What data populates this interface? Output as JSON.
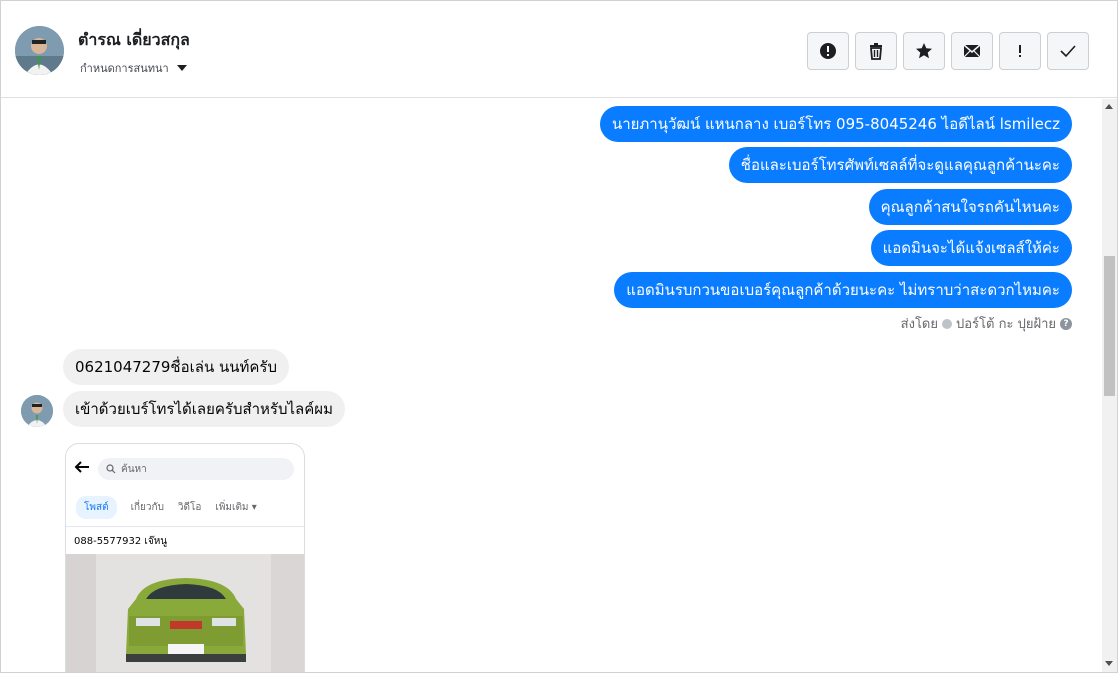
{
  "contact": {
    "name": "ตำรณ เดี่ยวสกุล",
    "subtitle": "กำหนดการสนทนา"
  },
  "toolbar": {
    "buttons": [
      {
        "name": "alert",
        "icon": "alert-circle-icon"
      },
      {
        "name": "delete",
        "icon": "trash-icon"
      },
      {
        "name": "star",
        "icon": "star-icon"
      },
      {
        "name": "mail",
        "icon": "envelope-icon"
      },
      {
        "name": "important",
        "icon": "exclamation-icon"
      },
      {
        "name": "done",
        "icon": "check-icon"
      }
    ]
  },
  "outgoing": [
    "นายภานุวัฒน์ แหนกลาง เบอร์โทร 095-8045246 ไอดีไลน์ lsmilecz",
    "ชื่อและเบอร์โทรศัพท์เซลล์ที่จะดูแลคุณลูกค้านะคะ",
    "คุณลูกค้าสนใจรถคันไหนคะ",
    "แอดมินจะได้แจ้งเซลส์ให้ค่ะ",
    "แอดมินรบกวนขอเบอร์คุณลูกค้าด้วยนะคะ ไม่ทราบว่าสะดวกไหมคะ"
  ],
  "sent_by": {
    "prefix": "ส่งโดย",
    "name": "ปอร์โต้ กะ ปุยฝ้าย"
  },
  "incoming": [
    "0621047279ชื่อเล่น นนท์ครับ",
    "เข้าด้วยเบร์โทรได้เลยครับสำหรับไลค์ผม"
  ],
  "shared_image": {
    "search_placeholder": "ค้นหา",
    "tabs": [
      "โพสต์",
      "เกี่ยวกับ",
      "วิดีโอ",
      "เพิ่มเติม"
    ],
    "caption": "088-5577932 เจ๊หนู"
  },
  "colors": {
    "outgoing_bubble": "#0a7cff",
    "incoming_bubble": "#f0f0f0"
  }
}
